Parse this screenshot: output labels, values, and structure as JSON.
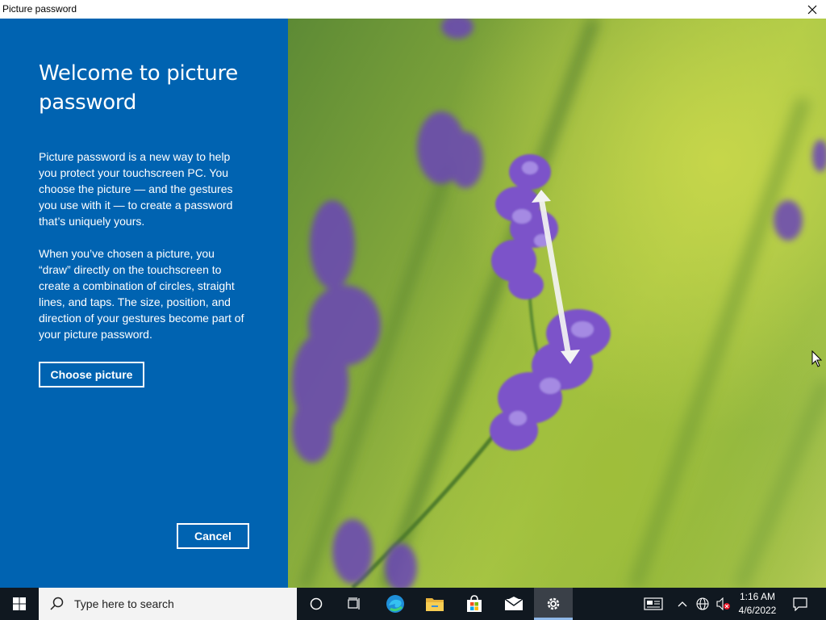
{
  "window": {
    "title": "Picture password"
  },
  "panel": {
    "heading": "Welcome to picture password",
    "paragraph1": "Picture password is a new way to help you protect your touchscreen PC. You choose the picture — and the gestures you use with it — to create a password that’s uniquely yours.",
    "paragraph2": "When you’ve chosen a picture, you “draw” directly on the touchscreen to create a combination of circles, straight lines, and taps. The size, position, and direction of your gestures become part of your picture password.",
    "choose_label": "Choose picture",
    "cancel_label": "Cancel"
  },
  "taskbar": {
    "search_placeholder": "Type here to search",
    "time": "1:16 AM",
    "date": "4/6/2022",
    "pinned": [
      "cortana-icon",
      "task-view-icon",
      "edge-icon",
      "file-explorer-icon",
      "store-icon",
      "mail-icon",
      "settings-icon"
    ],
    "tray": [
      "news-icon",
      "chevron-up-icon",
      "network-icon",
      "volume-muted-icon",
      "notifications-icon"
    ]
  },
  "colors": {
    "panel_blue": "#0063b1",
    "taskbar": "#101820",
    "flower_purple": "#7b52c9"
  }
}
